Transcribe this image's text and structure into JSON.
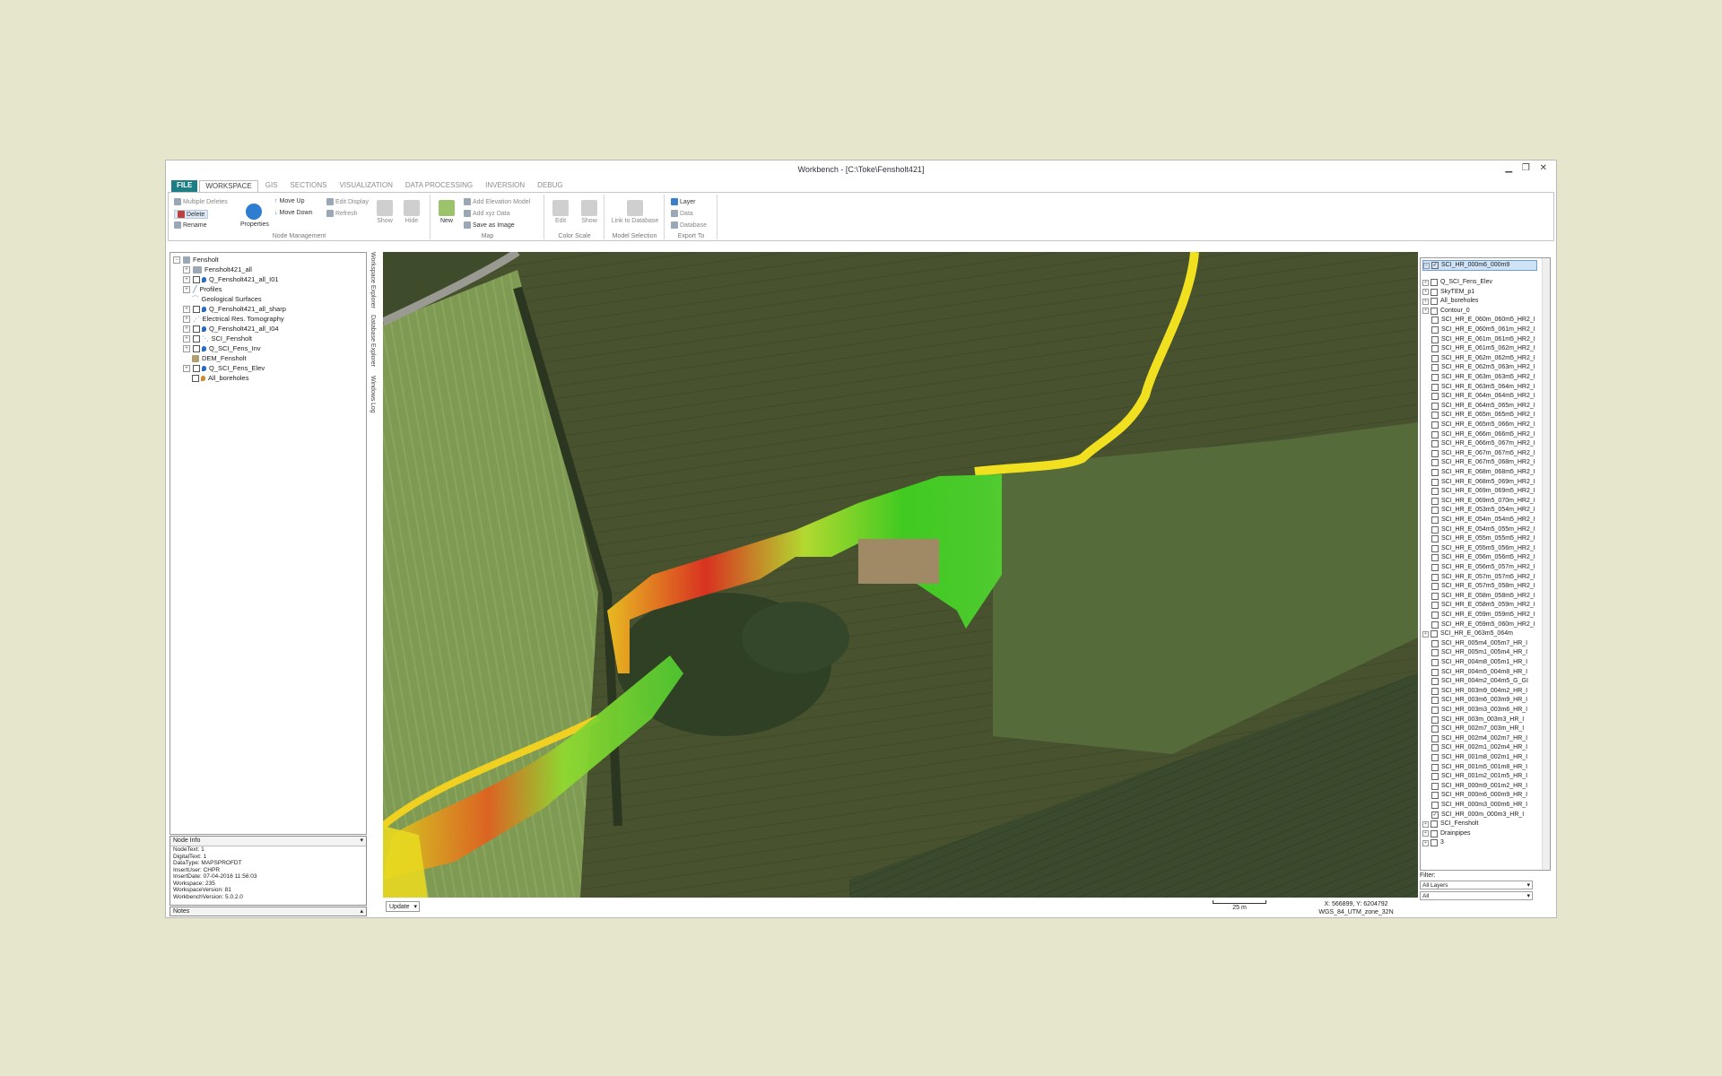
{
  "window": {
    "title": "Workbench - [C:\\Toke\\Fensholt421]"
  },
  "menu": {
    "tabs": [
      "FILE",
      "WORKSPACE",
      "GIS",
      "SECTIONS",
      "VISUALIZATION",
      "DATA PROCESSING",
      "INVERSION",
      "DEBUG"
    ]
  },
  "ribbon": {
    "node_management": {
      "label": "Node Management",
      "multiple_deletes": "Multiple Deletes",
      "delete": "Delete",
      "rename": "Rename",
      "properties": "Properties",
      "move_up": "Move Up",
      "move_down": "Move Down",
      "edit_display": "Edit Display",
      "refresh": "Refresh",
      "show": "Show",
      "hide": "Hide"
    },
    "map": {
      "label": "Map",
      "new": "New",
      "add_elevation": "Add Elevation Model",
      "add_xyz": "Add xyz Data",
      "save_image": "Save as Image"
    },
    "color_scale": {
      "label": "Color Scale",
      "edit": "Edit",
      "show": "Show"
    },
    "model_selection": {
      "label": "Model Selection",
      "link": "Link to Database"
    },
    "export_to": {
      "label": "Export To",
      "layer": "Layer",
      "data": "Data",
      "database": "Database"
    }
  },
  "workspace_tree": [
    "Fensholt",
    "Fensholt421_all",
    "Q_Fensholt421_all_I01",
    "Profiles",
    "Geological Surfaces",
    "Q_Fensholt421_all_sharp",
    "Electrical Res. Tomography",
    "Q_Fensholt421_all_I04",
    "SCI_Fensholt",
    "Q_SCI_Fens_Inv",
    "DEM_Fensholt",
    "Q_SCI_Fens_Elev",
    "All_boreholes"
  ],
  "side_tabs": [
    "Workspace Explorer",
    "Database Explorer",
    "Windows",
    "Log"
  ],
  "node_info": {
    "title": "Node Info",
    "lines": [
      "NodeText:  1",
      "DigitalText:  1",
      "DataType:  MAPSPROFDT",
      "InsertUser:  CHPR",
      "InsertDate:  07-04-2016 11:56:03",
      "Workspace:  235",
      "WorkspaceVersion:  81",
      "WorkbenchVersion:  5.0.2.0"
    ]
  },
  "notes": {
    "title": "Notes"
  },
  "statusbar": {
    "update": "Update",
    "scale": "25 m",
    "coords": "X: 566899, Y: 6204792",
    "crs": "WGS_84_UTM_zone_32N"
  },
  "layers": {
    "top": "SCI_HR_000m6_000m9",
    "items": [
      "Q_SCI_Fens_Elev",
      "SkyTEM_p1",
      "All_boreholes",
      "Contour_0",
      "SCI_HR_E_060m_060m5_HR2_I",
      "SCI_HR_E_060m5_061m_HR2_I",
      "SCI_HR_E_061m_061m5_HR2_I",
      "SCI_HR_E_061m5_062m_HR2_I",
      "SCI_HR_E_062m_062m5_HR2_I",
      "SCI_HR_E_062m5_063m_HR2_I",
      "SCI_HR_E_063m_063m5_HR2_I",
      "SCI_HR_E_063m5_064m_HR2_I",
      "SCI_HR_E_064m_064m5_HR2_I",
      "SCI_HR_E_064m5_065m_HR2_I",
      "SCI_HR_E_065m_065m5_HR2_I",
      "SCI_HR_E_065m5_066m_HR2_I",
      "SCI_HR_E_066m_066m5_HR2_I",
      "SCI_HR_E_066m5_067m_HR2_I",
      "SCI_HR_E_067m_067m5_HR2_I",
      "SCI_HR_E_067m5_068m_HR2_I",
      "SCI_HR_E_068m_068m5_HR2_I",
      "SCI_HR_E_068m5_069m_HR2_I",
      "SCI_HR_E_069m_069m5_HR2_I",
      "SCI_HR_E_069m5_070m_HR2_I",
      "SCI_HR_E_053m5_054m_HR2_I",
      "SCI_HR_E_054m_054m5_HR2_I",
      "SCI_HR_E_054m5_055m_HR2_I",
      "SCI_HR_E_055m_055m5_HR2_I",
      "SCI_HR_E_055m5_056m_HR2_I",
      "SCI_HR_E_056m_056m5_HR2_I",
      "SCI_HR_E_056m5_057m_HR2_I",
      "SCI_HR_E_057m_057m5_HR2_I",
      "SCI_HR_E_057m5_058m_HR2_I",
      "SCI_HR_E_058m_058m5_HR2_I",
      "SCI_HR_E_058m5_059m_HR2_I",
      "SCI_HR_E_059m_059m5_HR2_I",
      "SCI_HR_E_059m5_060m_HR2_I",
      "SCI_HR_E_063m5_064m",
      "SCI_HR_005m4_005m7_HR_I",
      "SCI_HR_005m1_005m4_HR_I",
      "SCI_HR_004m8_005m1_HR_I",
      "SCI_HR_004m5_004m8_HR_I",
      "SCI_HR_004m2_004m5_G_GI",
      "SCI_HR_003m9_004m2_HR_I",
      "SCI_HR_003m6_003m9_HR_I",
      "SCI_HR_003m3_003m6_HR_I",
      "SCI_HR_003m_003m3_HR_I",
      "SCI_HR_002m7_003m_HR_I",
      "SCI_HR_002m4_002m7_HR_I",
      "SCI_HR_002m1_002m4_HR_I",
      "SCI_HR_001m8_002m1_HR_I",
      "SCI_HR_001m5_001m8_HR_I",
      "SCI_HR_001m2_001m5_HR_I",
      "SCI_HR_000m9_001m2_HR_I",
      "SCI_HR_000m6_000m9_HR_I",
      "SCI_HR_000m3_000m6_HR_I",
      "SCI_HR_000m_000m3_HR_I",
      "SCI_Fensholt",
      "Drainpipes",
      "3"
    ]
  },
  "filter": {
    "label": "Filter:",
    "layer_option": "All Layers",
    "all_option": "All"
  }
}
